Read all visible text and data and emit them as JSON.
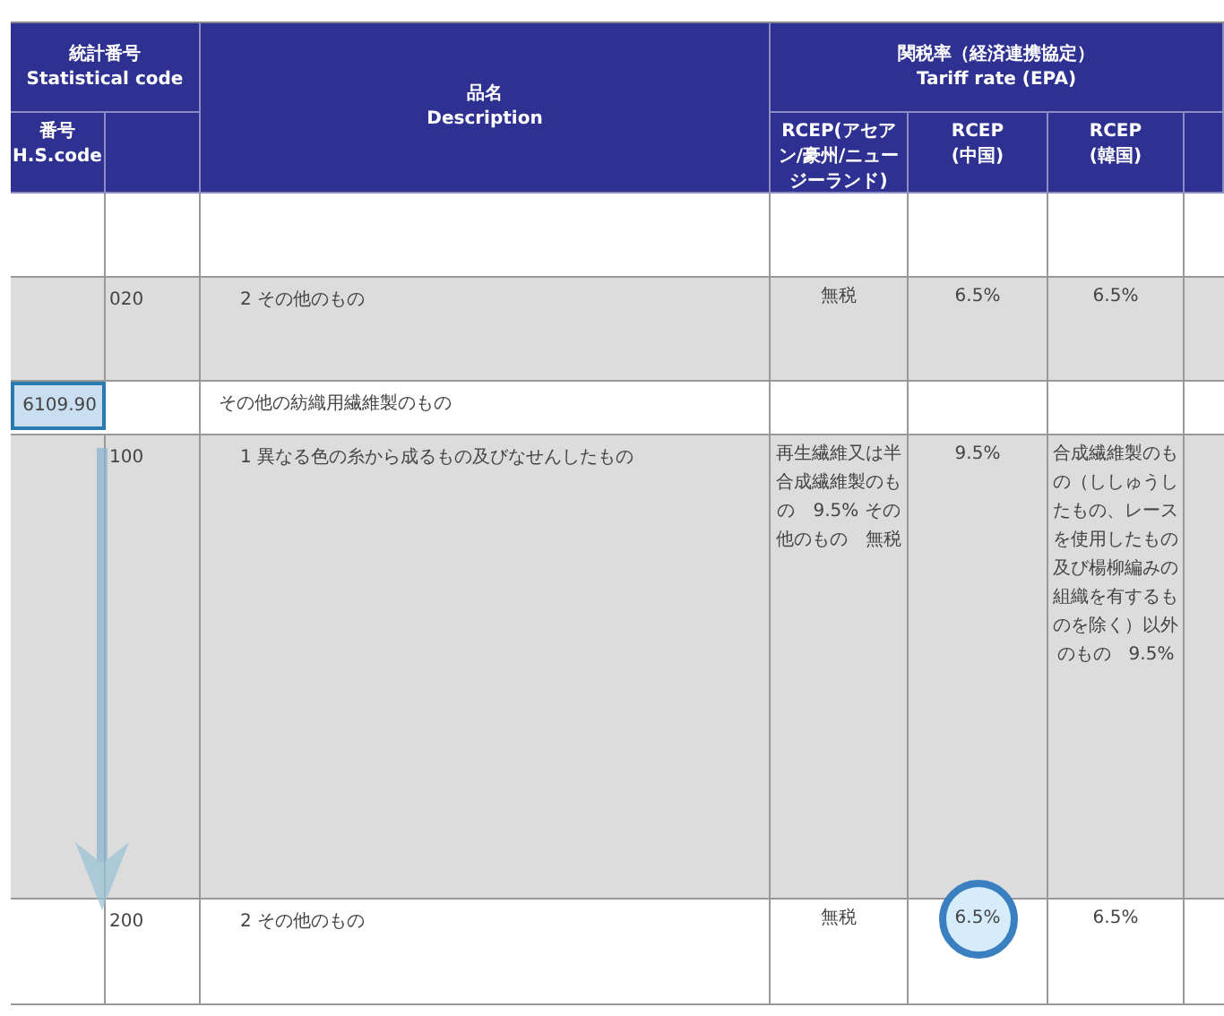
{
  "table": {
    "header": {
      "statistical_code": {
        "ja": "統計番号",
        "en": "Statistical code"
      },
      "hs_code": {
        "ja": "番号",
        "en": "H.S.code"
      },
      "description": {
        "ja": "品名",
        "en": "Description"
      },
      "tariff_rate": {
        "ja": "関税率（経済連携協定）",
        "en": "Tariff rate (EPA)"
      },
      "rate_columns": [
        "RCEP(アセアン/豪州/ニュージーランド)",
        "RCEP\n(中国)",
        "RCEP\n(韓国)"
      ]
    },
    "rows": [
      {
        "kind": "blank",
        "shaded": false,
        "selected": false,
        "hs_code": "",
        "sub_code": "",
        "description": "",
        "rates": []
      },
      {
        "kind": "item",
        "shaded": true,
        "selected": false,
        "hs_code": "",
        "sub_code": "020",
        "description": "2 その他のもの",
        "rates": [
          {
            "text": "無税",
            "circled": false
          },
          {
            "text": "6.5%",
            "circled": false
          },
          {
            "text": "6.5%",
            "circled": false
          }
        ]
      },
      {
        "kind": "heading",
        "shaded": false,
        "selected": true,
        "hs_code": "6109.90",
        "sub_code": "",
        "description": "その他の紡織用繊維製のもの",
        "rates": []
      },
      {
        "kind": "item",
        "shaded": true,
        "selected": false,
        "hs_code": "",
        "sub_code": "100",
        "description": "1 異なる色の糸から成るもの及びなせんしたもの",
        "rates": [
          {
            "text": "再生繊維又は半合成繊維製のもの　9.5% その他のもの　無税",
            "circled": false
          },
          {
            "text": "9.5%",
            "circled": false
          },
          {
            "text": "合成繊維製のもの（ししゅうしたもの、レースを使用したもの及び楊柳編みの組織を有するものを除く）以外のもの　9.5%",
            "circled": false
          }
        ]
      },
      {
        "kind": "item",
        "shaded": false,
        "selected": false,
        "hs_code": "",
        "sub_code": "200",
        "description": "2 その他のもの",
        "rates": [
          {
            "text": "無税",
            "circled": false
          },
          {
            "text": "6.5%",
            "circled": true
          },
          {
            "text": "6.5%",
            "circled": false
          }
        ]
      }
    ]
  }
}
